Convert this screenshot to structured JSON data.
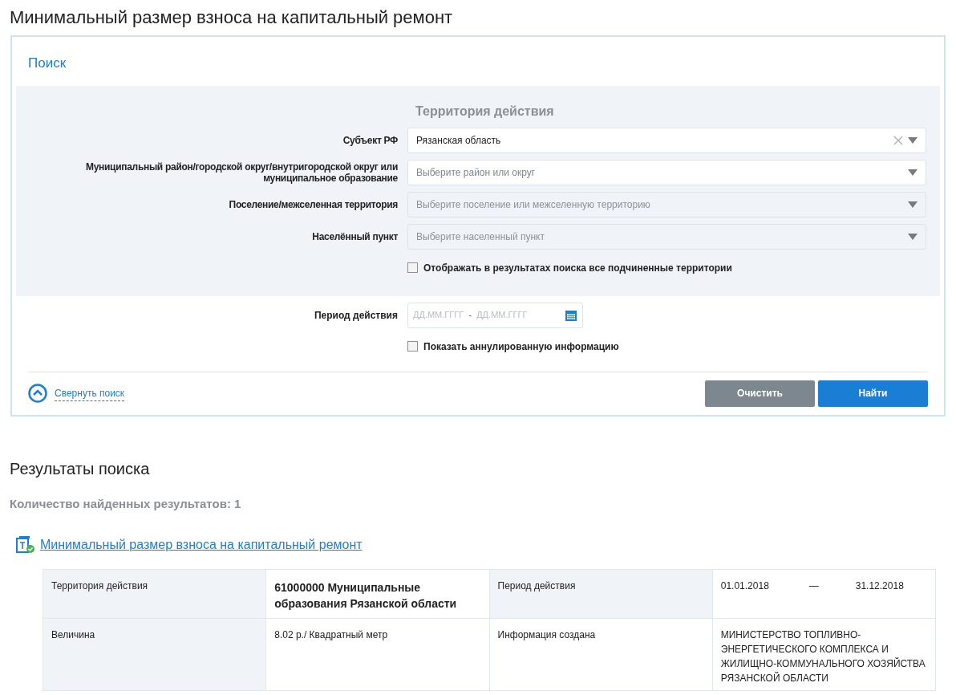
{
  "title": "Минимальный размер взноса на капитальный ремонт",
  "search": {
    "heading": "Поиск",
    "territory_heading": "Территория действия",
    "fields": [
      {
        "label": "Субъект РФ",
        "value": "Рязанская область",
        "disabled": false,
        "clearable": true
      },
      {
        "label": "Муниципальный район/городской округ/внутригородской округ или муниципальное образование",
        "placeholder": "Выберите район или округ",
        "disabled": false,
        "clearable": false
      },
      {
        "label": "Поселение/межселенная территория",
        "placeholder": "Выберите поселение или межселенную территорию",
        "disabled": true,
        "clearable": false
      },
      {
        "label": "Населённый пункт",
        "placeholder": "Выберите населенный пункт",
        "disabled": true,
        "clearable": false
      }
    ],
    "subordinate_checkbox": {
      "label": "Отображать в результатах поиска все подчиненные территории",
      "checked": false
    },
    "period": {
      "label": "Период действия",
      "from_placeholder": "ДД.ММ.ГГГГ",
      "separator": "-",
      "to_placeholder": "ДД.ММ.ГГГГ"
    },
    "annulled_checkbox": {
      "label": "Показать аннулированную информацию",
      "checked": false
    },
    "collapse_link": "Свернуть поиск",
    "buttons": [
      {
        "label": "Очистить",
        "kind": "secondary"
      },
      {
        "label": "Найти",
        "kind": "primary"
      }
    ]
  },
  "results": {
    "heading": "Результаты поиска",
    "count": "Количество найденных результатов: 1",
    "item_link": "Минимальный размер взноса на капитальный ремонт",
    "rows": [
      [
        {
          "kind": "label",
          "text": "Территория действия"
        },
        {
          "kind": "strong",
          "text": "61000000 Муниципальные образования Рязанской области"
        },
        {
          "kind": "label",
          "text": "Период действия"
        },
        {
          "kind": "range",
          "from": "01.01.2018",
          "dash": "—",
          "to": "31.12.2018"
        }
      ],
      [
        {
          "kind": "label",
          "text": "Величина"
        },
        {
          "kind": "value",
          "text": "8.02 р./ Квадратный метр"
        },
        {
          "kind": "value",
          "text": "Информация создана"
        },
        {
          "kind": "value",
          "text": "МИНИСТЕРСТВО ТОПЛИВНО-ЭНЕРГЕТИЧЕСКОГО КОМПЛЕКСА И ЖИЛИЩНО-КОММУНАЛЬНОГО ХОЗЯЙСТВА РЯЗАНСКОЙ ОБЛАСТИ"
        }
      ]
    ]
  }
}
